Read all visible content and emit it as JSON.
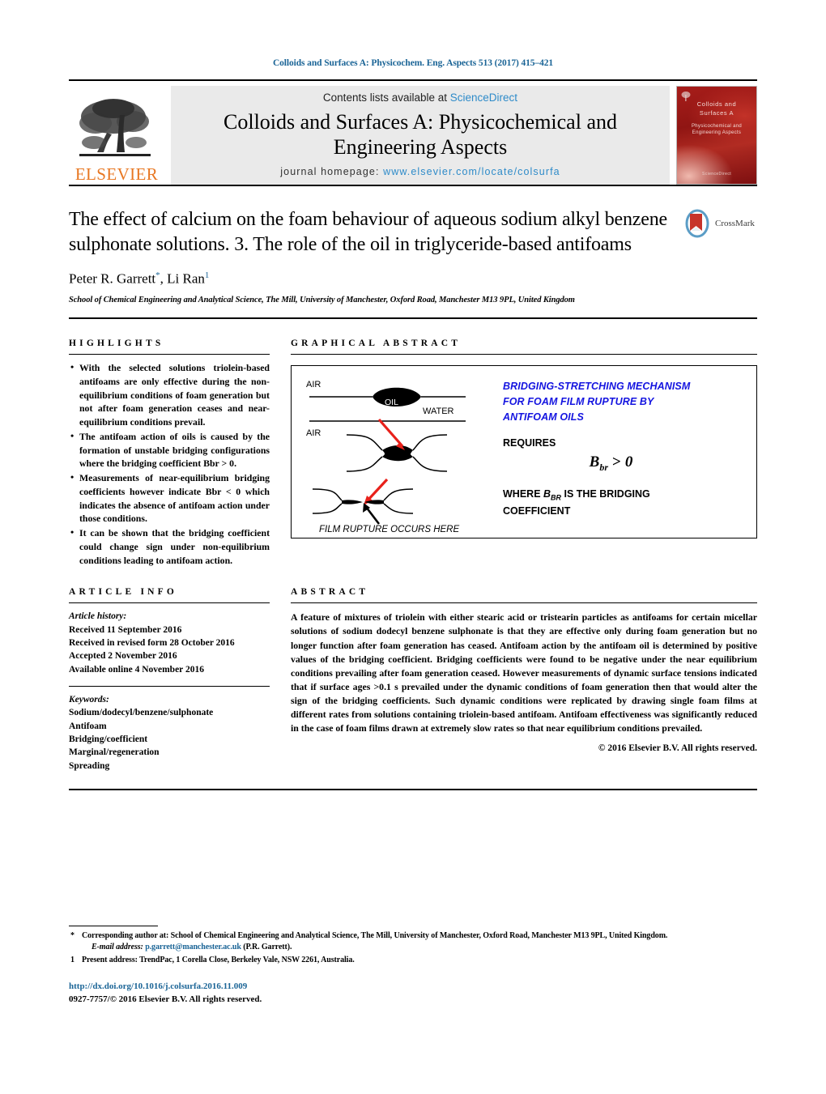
{
  "running_head": "Colloids and Surfaces A: Physicochem. Eng. Aspects 513 (2017) 415–421",
  "masthead": {
    "contents_prefix": "Contents lists available at",
    "sciencedirect": "ScienceDirect",
    "journal_title_line1": "Colloids and Surfaces A: Physicochemical and",
    "journal_title_line2": "Engineering Aspects",
    "homepage_prefix": "journal homepage:",
    "homepage_url": "www.elsevier.com/locate/colsurfa",
    "publisher": "ELSEVIER",
    "cover": {
      "line1": "Colloids and",
      "line2": "Surfaces A",
      "line3": "Physicochemical and",
      "line4": "Engineering Aspects",
      "footer": "ScienceDirect"
    }
  },
  "article": {
    "title": "The effect of calcium on the foam behaviour of aqueous sodium alkyl benzene sulphonate solutions. 3. The role of the oil in triglyceride-based antifoams",
    "authors_part1": "Peter R. Garrett",
    "authors_sep": ", Li Ran",
    "corresponding_mark": "*",
    "author2_mark": "1",
    "affiliation": "School of Chemical Engineering and Analytical Science, The Mill, University of Manchester, Oxford Road, Manchester M13 9PL, United Kingdom",
    "crossmark_label": "CrossMark"
  },
  "highlights": {
    "heading": "HIGHLIGHTS",
    "items": [
      "With the selected solutions triolein-based antifoams are only effective during the non-equilibrium conditions of foam generation but not after foam generation ceases and near-equilibrium conditions prevail.",
      "The antifoam action of oils is caused by the formation of unstable bridging configurations where the bridging coefficient Bbr > 0.",
      "Measurements of near-equilibrium bridging coefficients however indicate Bbr < 0 which indicates the absence of antifoam action under those conditions.",
      "It can be shown that the bridging coefficient could change sign under non-equilibrium conditions leading to antifoam action."
    ]
  },
  "graphical_abstract": {
    "heading": "GRAPHICAL ABSTRACT",
    "diagram": {
      "label_air_top": "AIR",
      "label_oil": "OIL",
      "label_water": "WATER",
      "label_air_second": "AIR",
      "caption": "FILM RUPTURE OCCURS HERE"
    },
    "blue_title_line1": "BRIDGING-STRETCHING MECHANISM",
    "blue_title_line2": "FOR FOAM FILM RUPTURE BY",
    "blue_title_line3": "ANTIFOAM OILS",
    "requires_label": "REQUIRES",
    "formula_symbol": "B",
    "formula_sub": "br",
    "formula_rel": ">",
    "formula_value": "0",
    "where_prefix": "WHERE ",
    "where_symbol": "B",
    "where_sub": "BR",
    "where_suffix": " IS THE BRIDGING",
    "where_line2": "COEFFICIENT"
  },
  "article_info": {
    "heading": "ARTICLE INFO",
    "history_label": "Article history:",
    "history": [
      "Received 11 September 2016",
      "Received in revised form 28 October 2016",
      "Accepted 2 November 2016",
      "Available online 4 November 2016"
    ],
    "keywords_label": "Keywords:",
    "keywords": [
      "Sodium/dodecyl/benzene/sulphonate",
      "Antifoam",
      "Bridging/coefficient",
      "Marginal/regeneration",
      "Spreading"
    ]
  },
  "abstract": {
    "heading": "ABSTRACT",
    "body": "A feature of mixtures of triolein with either stearic acid or tristearin particles as antifoams for certain micellar solutions of sodium dodecyl benzene sulphonate is that they are effective only during foam generation but no longer function after foam generation has ceased. Antifoam action by the antifoam oil is determined by positive values of the bridging coefficient. Bridging coefficients were found to be negative under the near equilibrium conditions prevailing after foam generation ceased. However measurements of dynamic surface tensions indicated that if surface ages >0.1 s prevailed under the dynamic conditions of foam generation then that would alter the sign of the bridging coefficients. Such dynamic conditions were replicated by drawing single foam films at different rates from solutions containing triolein-based antifoam. Antifoam effectiveness was significantly reduced in the case of foam films drawn at extremely slow rates so that near equilibrium conditions prevailed.",
    "copyright": "© 2016 Elsevier B.V. All rights reserved."
  },
  "footnotes": {
    "corresponding_mark": "*",
    "corresponding_text": "Corresponding author at: School of Chemical Engineering and Analytical Science, The Mill, University of Manchester, Oxford Road, Manchester M13 9PL, United Kingdom.",
    "email_label": "E-mail address:",
    "email": "p.garrett@manchester.ac.uk",
    "email_suffix": "(P.R. Garrett).",
    "present_mark": "1",
    "present_text": "Present address: TrendPac, 1 Corella Close, Berkeley Vale, NSW 2261, Australia."
  },
  "footer": {
    "doi": "http://dx.doi.org/10.1016/j.colsurfa.2016.11.009",
    "issn_line": "0927-7757/© 2016 Elsevier B.V. All rights reserved."
  },
  "colors": {
    "link_blue": "#1a6496",
    "sciencedirect_blue": "#2e8bc9",
    "elsevier_orange": "#E87722",
    "ga_blue": "#1414e0",
    "arrow_red": "#e8211b"
  }
}
